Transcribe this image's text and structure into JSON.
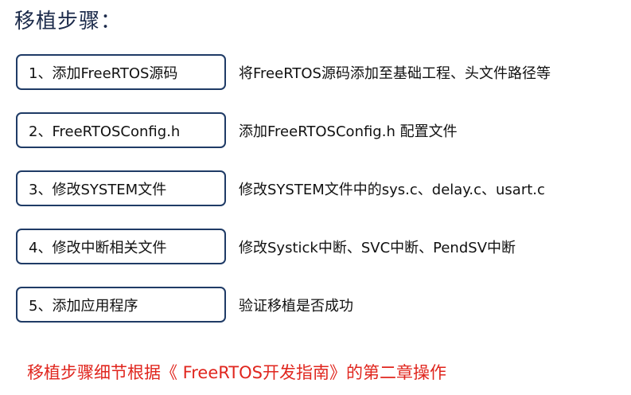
{
  "title": "移植步骤：",
  "steps": [
    {
      "label": "1、添加FreeRTOS源码",
      "description": "将FreeRTOS源码添加至基础工程、头文件路径等"
    },
    {
      "label": "2、FreeRTOSConfig.h",
      "description": "添加FreeRTOSConfig.h 配置文件"
    },
    {
      "label": "3、修改SYSTEM文件",
      "description": "修改SYSTEM文件中的sys.c、delay.c、usart.c"
    },
    {
      "label": "4、修改中断相关文件",
      "description": "修改Systick中断、SVC中断、PendSV中断"
    },
    {
      "label": "5、添加应用程序",
      "description": "验证移植是否成功"
    }
  ],
  "footer_note": "移植步骤细节根据《 FreeRTOS开发指南》的第二章操作",
  "colors": {
    "box_border": "#1f3b66",
    "footer_text": "#e0261e"
  }
}
